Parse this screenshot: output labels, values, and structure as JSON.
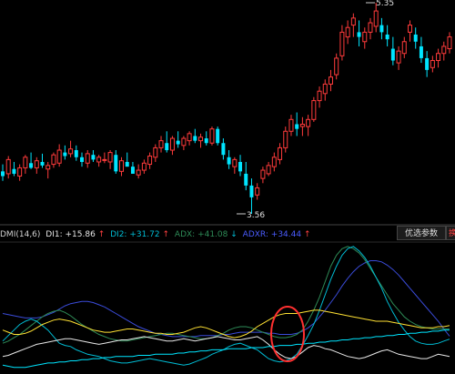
{
  "colors": {
    "background": "#000000",
    "up": "#ff3b3b",
    "down": "#00e5ff",
    "di1": "#e8e8e8",
    "di2": "#00bcd4",
    "adx": "#2e8b57",
    "adxr": "#3a4bd8",
    "yellow": "#ffe133",
    "highlight_circle": "#ff3030"
  },
  "price_panel": {
    "high_label": "5.35",
    "low_label": "3.56"
  },
  "indicator_header": {
    "name": "DMI(14,6)",
    "di1": "DI1: +15.86",
    "di1_arrow": "↑",
    "di2": "DI2: +31.72",
    "di2_arrow": "↑",
    "adx": "ADX: +41.08",
    "adx_arrow": "↓",
    "adxr": "ADXR: +34.44",
    "adxr_arrow": "↑"
  },
  "buttons": {
    "params": "优选参数",
    "switch": "换"
  },
  "chart_data": {
    "type": "candlestick",
    "candles": [
      [
        3.92,
        3.98,
        3.84,
        3.88
      ],
      [
        3.9,
        4.05,
        3.86,
        4.02
      ],
      [
        3.94,
        4.0,
        3.88,
        3.9
      ],
      [
        3.88,
        3.98,
        3.84,
        3.95
      ],
      [
        3.95,
        4.06,
        3.9,
        4.04
      ],
      [
        3.99,
        4.08,
        3.94,
        3.95
      ],
      [
        3.95,
        4.04,
        3.9,
        4.01
      ],
      [
        4.0,
        4.07,
        3.95,
        3.97
      ],
      [
        3.94,
        4.0,
        3.86,
        3.97
      ],
      [
        3.98,
        4.08,
        3.95,
        4.06
      ],
      [
        3.99,
        4.15,
        3.96,
        4.1
      ],
      [
        4.08,
        4.14,
        4.02,
        4.05
      ],
      [
        4.07,
        4.18,
        4.04,
        4.11
      ],
      [
        4.1,
        4.14,
        4.01,
        4.04
      ],
      [
        4.04,
        4.08,
        3.96,
        4.0
      ],
      [
        3.99,
        4.1,
        3.95,
        4.07
      ],
      [
        4.06,
        4.1,
        4.0,
        4.02
      ],
      [
        4.0,
        4.06,
        3.96,
        4.04
      ],
      [
        4.02,
        4.08,
        3.99,
        4.02
      ],
      [
        4.0,
        4.1,
        3.94,
        4.08
      ],
      [
        4.06,
        4.1,
        3.9,
        3.92
      ],
      [
        3.92,
        4.04,
        3.88,
        4.01
      ],
      [
        4.0,
        4.08,
        3.96,
        3.96
      ],
      [
        3.96,
        4.0,
        3.9,
        3.9
      ],
      [
        3.89,
        3.98,
        3.86,
        3.93
      ],
      [
        3.93,
        4.02,
        3.9,
        3.99
      ],
      [
        3.98,
        4.08,
        3.94,
        4.05
      ],
      [
        4.04,
        4.15,
        4.0,
        4.12
      ],
      [
        4.12,
        4.22,
        4.08,
        4.18
      ],
      [
        4.16,
        4.26,
        4.08,
        4.1
      ],
      [
        4.1,
        4.22,
        4.06,
        4.2
      ],
      [
        4.18,
        4.26,
        4.12,
        4.15
      ],
      [
        4.14,
        4.22,
        4.1,
        4.2
      ],
      [
        4.18,
        4.26,
        4.14,
        4.24
      ],
      [
        4.22,
        4.28,
        4.16,
        4.18
      ],
      [
        4.18,
        4.24,
        4.12,
        4.21
      ],
      [
        4.2,
        4.26,
        4.14,
        4.16
      ],
      [
        4.16,
        4.3,
        4.14,
        4.28
      ],
      [
        4.28,
        4.3,
        4.14,
        4.16
      ],
      [
        4.16,
        4.2,
        4.02,
        4.06
      ],
      [
        4.04,
        4.1,
        3.94,
        3.98
      ],
      [
        3.96,
        4.04,
        3.9,
        4.02
      ],
      [
        4.0,
        4.06,
        3.88,
        3.92
      ],
      [
        3.9,
        4.0,
        3.76,
        3.8
      ],
      [
        3.8,
        3.86,
        3.56,
        3.7
      ],
      [
        3.72,
        3.82,
        3.68,
        3.78
      ],
      [
        3.86,
        3.96,
        3.82,
        3.93
      ],
      [
        3.9,
        4.0,
        3.88,
        3.97
      ],
      [
        3.96,
        4.08,
        3.92,
        4.04
      ],
      [
        4.02,
        4.16,
        3.98,
        4.12
      ],
      [
        4.12,
        4.3,
        4.08,
        4.26
      ],
      [
        4.26,
        4.4,
        4.22,
        4.36
      ],
      [
        4.32,
        4.42,
        4.22,
        4.28
      ],
      [
        4.3,
        4.38,
        4.22,
        4.32
      ],
      [
        4.3,
        4.4,
        4.22,
        4.36
      ],
      [
        4.36,
        4.55,
        4.34,
        4.52
      ],
      [
        4.52,
        4.64,
        4.46,
        4.6
      ],
      [
        4.58,
        4.7,
        4.52,
        4.66
      ],
      [
        4.66,
        4.78,
        4.6,
        4.72
      ],
      [
        4.74,
        4.92,
        4.7,
        4.88
      ],
      [
        4.9,
        5.16,
        4.86,
        5.1
      ],
      [
        5.06,
        5.2,
        5.0,
        5.14
      ],
      [
        5.16,
        5.26,
        5.06,
        5.22
      ],
      [
        5.1,
        5.2,
        4.98,
        5.06
      ],
      [
        5.02,
        5.14,
        4.96,
        5.1
      ],
      [
        5.1,
        5.22,
        5.04,
        5.18
      ],
      [
        5.15,
        5.35,
        5.1,
        5.28
      ],
      [
        5.16,
        5.22,
        5.04,
        5.1
      ],
      [
        5.08,
        5.16,
        4.98,
        5.04
      ],
      [
        4.96,
        5.06,
        4.82,
        4.86
      ],
      [
        4.84,
        4.98,
        4.78,
        4.94
      ],
      [
        4.92,
        5.06,
        4.88,
        5.02
      ],
      [
        5.1,
        5.2,
        5.02,
        5.16
      ],
      [
        5.08,
        5.14,
        4.96,
        5.02
      ],
      [
        4.98,
        5.06,
        4.84,
        4.88
      ],
      [
        4.88,
        4.94,
        4.72,
        4.78
      ],
      [
        4.8,
        4.9,
        4.76,
        4.86
      ],
      [
        4.86,
        4.96,
        4.8,
        4.92
      ],
      [
        4.92,
        5.02,
        4.86,
        4.98
      ],
      [
        4.96,
        5.1,
        4.92,
        5.06
      ]
    ],
    "indicators": {
      "di1": [
        16,
        17,
        19,
        21,
        23,
        25,
        27,
        28,
        29,
        30,
        31,
        32,
        32,
        31,
        30,
        29,
        28,
        27,
        28,
        29,
        30,
        31,
        31,
        32,
        33,
        34,
        33,
        32,
        31,
        30,
        30,
        31,
        32,
        31,
        30,
        31,
        32,
        33,
        34,
        33,
        32,
        31,
        31,
        32,
        33,
        34,
        31,
        27,
        22,
        18,
        15,
        14,
        16,
        20,
        24,
        26,
        25,
        23,
        22,
        20,
        18,
        16,
        15,
        14,
        15,
        17,
        19,
        21,
        22,
        20,
        18,
        17,
        16,
        15,
        14,
        14,
        16,
        18,
        17,
        15.86
      ],
      "di2": [
        30,
        35,
        40,
        45,
        48,
        50,
        48,
        44,
        40,
        34,
        28,
        26,
        25,
        22,
        20,
        18,
        17,
        16,
        14,
        12,
        11,
        10,
        10,
        11,
        12,
        13,
        14,
        13,
        12,
        11,
        10,
        9,
        8,
        9,
        11,
        13,
        15,
        18,
        20,
        22,
        25,
        27,
        28,
        26,
        24,
        22,
        18,
        14,
        12,
        11,
        12,
        14,
        18,
        26,
        35,
        45,
        58,
        72,
        86,
        98,
        108,
        114,
        116,
        112,
        106,
        98,
        88,
        78,
        66,
        56,
        47,
        40,
        34,
        30,
        28,
        27,
        27,
        28,
        30,
        31.72
      ],
      "adx": [
        28,
        30,
        33,
        36,
        40,
        44,
        48,
        52,
        55,
        57,
        58,
        56,
        53,
        49,
        45,
        42,
        39,
        36,
        34,
        32,
        31,
        30,
        30,
        31,
        32,
        33,
        34,
        35,
        36,
        37,
        37,
        36,
        35,
        34,
        33,
        32,
        32,
        33,
        35,
        37,
        40,
        42,
        43,
        43,
        42,
        40,
        38,
        36,
        34,
        33,
        33,
        34,
        36,
        40,
        48,
        58,
        70,
        84,
        98,
        108,
        114,
        116,
        114,
        110,
        104,
        96,
        88,
        80,
        72,
        64,
        58,
        52,
        48,
        45,
        43,
        42,
        41,
        41,
        41,
        41.08
      ],
      "adxr": [
        55,
        54,
        53,
        52,
        51,
        51,
        51,
        52,
        54,
        56,
        59,
        62,
        64,
        65,
        66,
        66,
        65,
        63,
        61,
        58,
        55,
        52,
        49,
        46,
        43,
        41,
        39,
        37,
        36,
        35,
        34,
        34,
        34,
        34,
        34,
        35,
        35,
        35,
        35,
        36,
        36,
        37,
        38,
        38,
        38,
        38,
        38,
        37,
        37,
        36,
        36,
        36,
        37,
        39,
        42,
        46,
        52,
        58,
        65,
        72,
        80,
        87,
        93,
        98,
        101,
        103,
        103,
        102,
        99,
        95,
        90,
        84,
        78,
        72,
        66,
        60,
        54,
        48,
        41,
        34.44
      ],
      "yellow": [
        40,
        38,
        36,
        36,
        37,
        39,
        42,
        45,
        47,
        49,
        50,
        49,
        48,
        46,
        44,
        42,
        40,
        39,
        38,
        38,
        39,
        40,
        41,
        41,
        40,
        39,
        38,
        37,
        37,
        36,
        36,
        37,
        38,
        40,
        42,
        43,
        42,
        40,
        38,
        36,
        34,
        33,
        34,
        36,
        39,
        43,
        46,
        49,
        52,
        54,
        55,
        55,
        55,
        56,
        57,
        58,
        58,
        57,
        56,
        55,
        54,
        53,
        52,
        51,
        50,
        49,
        48,
        48,
        48,
        47,
        46,
        45,
        44,
        43,
        42,
        42,
        42,
        43,
        43,
        44
      ],
      "cyan": [
        8,
        7,
        6,
        6,
        6,
        7,
        8,
        9,
        10,
        10,
        11,
        11,
        12,
        12,
        13,
        13,
        14,
        14,
        15,
        15,
        16,
        16,
        16,
        16,
        17,
        17,
        17,
        18,
        18,
        18,
        18,
        19,
        19,
        20,
        20,
        21,
        21,
        22,
        22,
        22,
        23,
        23,
        23,
        23,
        24,
        24,
        24,
        25,
        25,
        26,
        26,
        26,
        27,
        27,
        28,
        28,
        29,
        29,
        30,
        30,
        31,
        31,
        32,
        32,
        33,
        33,
        34,
        34,
        35,
        35,
        36,
        36,
        37,
        37,
        38,
        38,
        39,
        39,
        40,
        40
      ]
    }
  }
}
